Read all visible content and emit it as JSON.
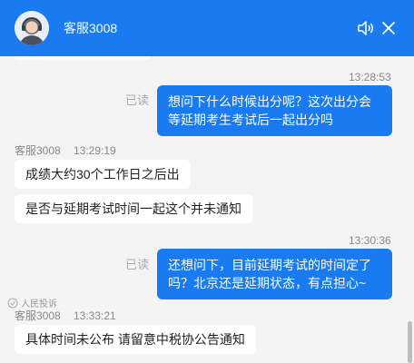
{
  "header": {
    "title": "客服3008",
    "icons": [
      "avatar-headset",
      "speaker-icon",
      "close-icon"
    ],
    "colors": {
      "brand": "#1a7af0"
    }
  },
  "messages": {
    "m1": {
      "time": "13:28:53",
      "status": "已读",
      "line1": "想问下什么时候出分呢？这次出分会",
      "line2": "等延期考生考试后一起出分吗"
    },
    "m2": {
      "sender": "客服3008",
      "time": "13:29:19",
      "text": "成绩大约30个工作日之后出"
    },
    "m3": {
      "text": "是否与延期考试时间一起这个并未通知"
    },
    "m4": {
      "time": "13:30:36",
      "status": "已读",
      "line1": "还想问下，目前延期考试的时间定了",
      "line2": "吗？北京还是延期状态，有点担心~"
    },
    "m5": {
      "sender": "客服3008",
      "time": "13:33:21",
      "text": "具体时间未公布 请留意中税协公告通知"
    }
  },
  "watermark": "人民投诉"
}
